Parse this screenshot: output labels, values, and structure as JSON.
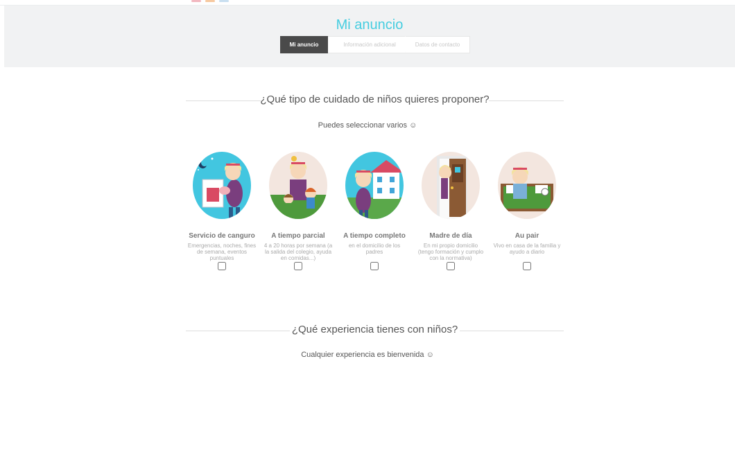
{
  "header": {
    "title": "Mi anuncio",
    "steps": [
      {
        "label": "Mi anuncio",
        "state": "active"
      },
      {
        "label": "Información adicional",
        "state": "inactive"
      },
      {
        "label": "Datos de contacto",
        "state": "inactive"
      }
    ]
  },
  "section_care": {
    "heading": "¿Qué tipo de cuidado de niños quieres proponer?",
    "subtitle": "Puedes seleccionar varios ☺",
    "options": [
      {
        "title": "Servicio de canguro",
        "desc": "Emergencias, noches, fines de semana, eventos puntuales",
        "checked": false,
        "icon": "babysitter-illustration"
      },
      {
        "title": "A tiempo parcial",
        "desc": "4 a 20 horas por semana (a la salida del colegio, ayuda en comidas...)",
        "checked": false,
        "icon": "part-time-illustration"
      },
      {
        "title": "A tiempo completo",
        "desc": "en el domicilio de los padres",
        "checked": false,
        "icon": "full-time-illustration"
      },
      {
        "title": "Madre de día",
        "desc": "En mi propio domicilio (tengo formación y cumplo con la normativa)",
        "checked": false,
        "icon": "day-mother-illustration"
      },
      {
        "title": "Au pair",
        "desc": "Vivo en casa de la familia y ayudo a diario",
        "checked": false,
        "icon": "au-pair-illustration"
      }
    ]
  },
  "section_experience": {
    "heading": "¿Qué experiencia tienes con niños?",
    "subtitle": "Cualquier experiencia es bienvenida ☺"
  },
  "colors": {
    "accent": "#45cde0",
    "step_active": "#4a4a4a",
    "banner_bg": "#f1f2f3"
  }
}
